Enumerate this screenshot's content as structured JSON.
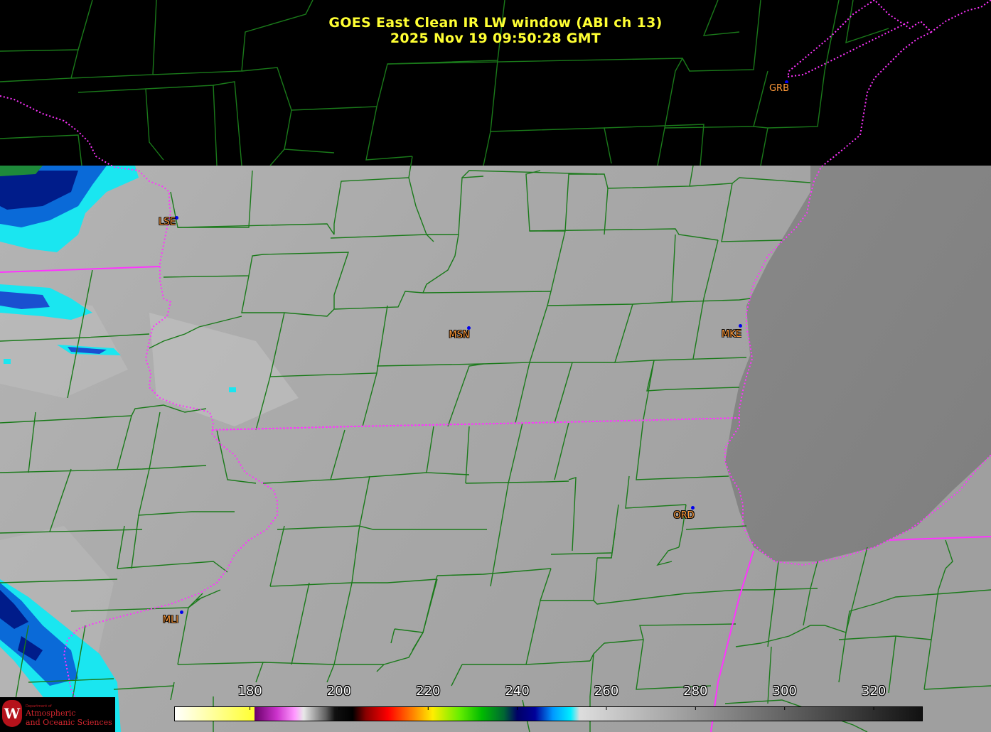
{
  "title": {
    "line1": "GOES East Clean IR LW window (ABI ch 13)",
    "line2": "2025 Nov 19  09:50:28 GMT"
  },
  "cities": [
    "LSE",
    "MSN",
    "MKE",
    "ORD",
    "MLI",
    "GRB"
  ],
  "logo": {
    "seal_letter": "W",
    "dept": "Department of",
    "line1": "Atmospheric",
    "line2": "and Oceanic Sciences"
  },
  "colorbar": {
    "unit_min": 163,
    "unit_max": 331,
    "ticks": [
      180,
      200,
      220,
      240,
      260,
      280,
      300,
      320
    ],
    "stops": [
      {
        "value": 163,
        "color": "#ffffff"
      },
      {
        "value": 181,
        "color": "#ffff30"
      },
      {
        "value": 181,
        "color": "#6a006a"
      },
      {
        "value": 186,
        "color": "#cc33cc"
      },
      {
        "value": 190,
        "color": "#ff99ff"
      },
      {
        "value": 192,
        "color": "#e8e8e8"
      },
      {
        "value": 197,
        "color": "#606060"
      },
      {
        "value": 199,
        "color": "#101010"
      },
      {
        "value": 203,
        "color": "#000000"
      },
      {
        "value": 206,
        "color": "#8a0000"
      },
      {
        "value": 211,
        "color": "#ff0000"
      },
      {
        "value": 216,
        "color": "#ff7700"
      },
      {
        "value": 221,
        "color": "#ffee00"
      },
      {
        "value": 227,
        "color": "#66ee00"
      },
      {
        "value": 232,
        "color": "#00bb00"
      },
      {
        "value": 237,
        "color": "#006633"
      },
      {
        "value": 240,
        "color": "#000066"
      },
      {
        "value": 244,
        "color": "#000099"
      },
      {
        "value": 248,
        "color": "#0099ff"
      },
      {
        "value": 252,
        "color": "#00eeff"
      },
      {
        "value": 254,
        "color": "#dddddd"
      },
      {
        "value": 331,
        "color": "#111111"
      }
    ]
  },
  "colors": {
    "county_lines": "#1a7a1a",
    "state_lines": "#ff33ff",
    "title": "#ffff33",
    "city_label": "#ff9a3a"
  }
}
